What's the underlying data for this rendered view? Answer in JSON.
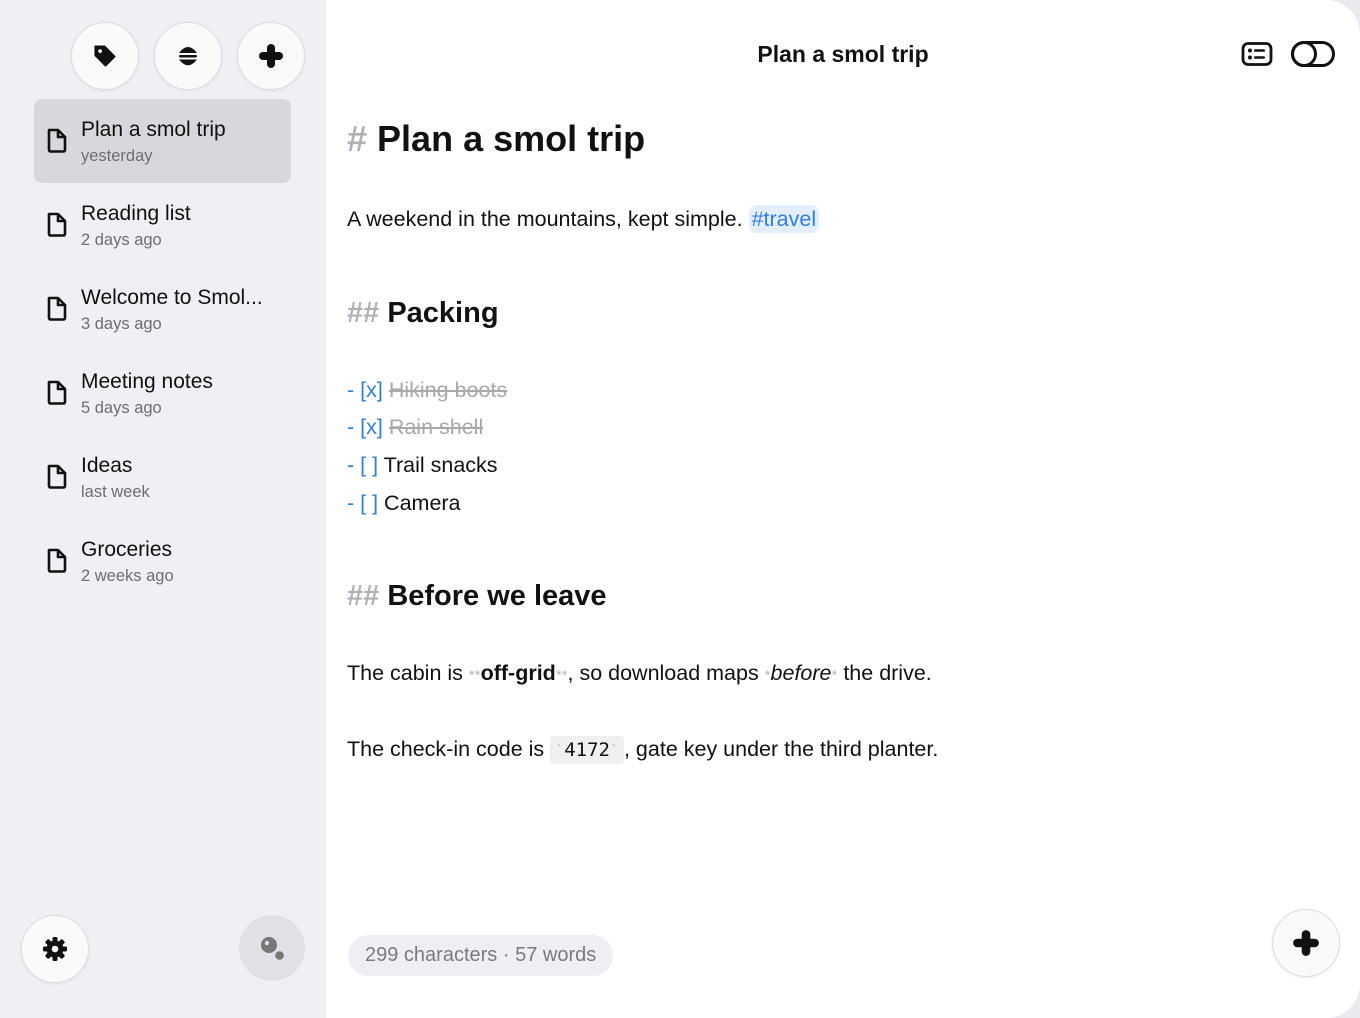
{
  "sidebar": {
    "toolbar": {
      "tag_icon": "tag-icon",
      "sort_icon": "sort-icon",
      "add_icon": "plus-icon"
    },
    "notes": [
      {
        "title": "Plan a smol trip",
        "date": "yesterday",
        "selected": true
      },
      {
        "title": "Reading list",
        "date": "2 days ago",
        "selected": false
      },
      {
        "title": "Welcome to Smol...",
        "date": "3 days ago",
        "selected": false
      },
      {
        "title": "Meeting notes",
        "date": "5 days ago",
        "selected": false
      },
      {
        "title": "Ideas",
        "date": "last week",
        "selected": false
      },
      {
        "title": "Groceries",
        "date": "2 weeks ago",
        "selected": false
      }
    ],
    "bottom": {
      "settings_icon": "gear-icon",
      "search_icon": "search-icon"
    }
  },
  "header": {
    "title": "Plan a smol trip",
    "list_icon": "list-view-icon",
    "toggle_icon": "toggle-icon"
  },
  "editor": {
    "h1_marker": "#",
    "h1_text": "Plan a smol trip",
    "intro_text": "A weekend in the mountains, kept simple.",
    "intro_tag": "#travel",
    "packing_marker": "##",
    "packing_heading": "Packing",
    "tasks": [
      {
        "marker": "- [x]",
        "text": "Hiking boots",
        "done": true
      },
      {
        "marker": "- [x]",
        "text": "Rain shell",
        "done": true
      },
      {
        "marker": "- [ ]",
        "text": "Trail snacks",
        "done": false
      },
      {
        "marker": "- [ ]",
        "text": "Camera",
        "done": false
      }
    ],
    "leave_marker": "##",
    "leave_heading": "Before we leave",
    "cabin": {
      "pre": "The cabin is ",
      "bold_mark_open": "**",
      "bold": "off-grid",
      "bold_mark_close": "**",
      "mid": ", so download maps ",
      "italic_mark_open": "*",
      "italic": "before",
      "italic_mark_close": "*",
      "post": " the drive."
    },
    "checkin": {
      "pre": "The check-in code is ",
      "code_mark_open": "`",
      "code": "4172",
      "code_mark_close": "`",
      "post": ", gate key under the third planter."
    }
  },
  "footer": {
    "stats": "299 characters · 57 words",
    "add_icon": "plus-icon"
  },
  "colors": {
    "accent": "#2f7ee6",
    "sidebar_bg": "#efeff4",
    "selected_bg": "#d7d7dc",
    "muted": "#6d6d72"
  }
}
